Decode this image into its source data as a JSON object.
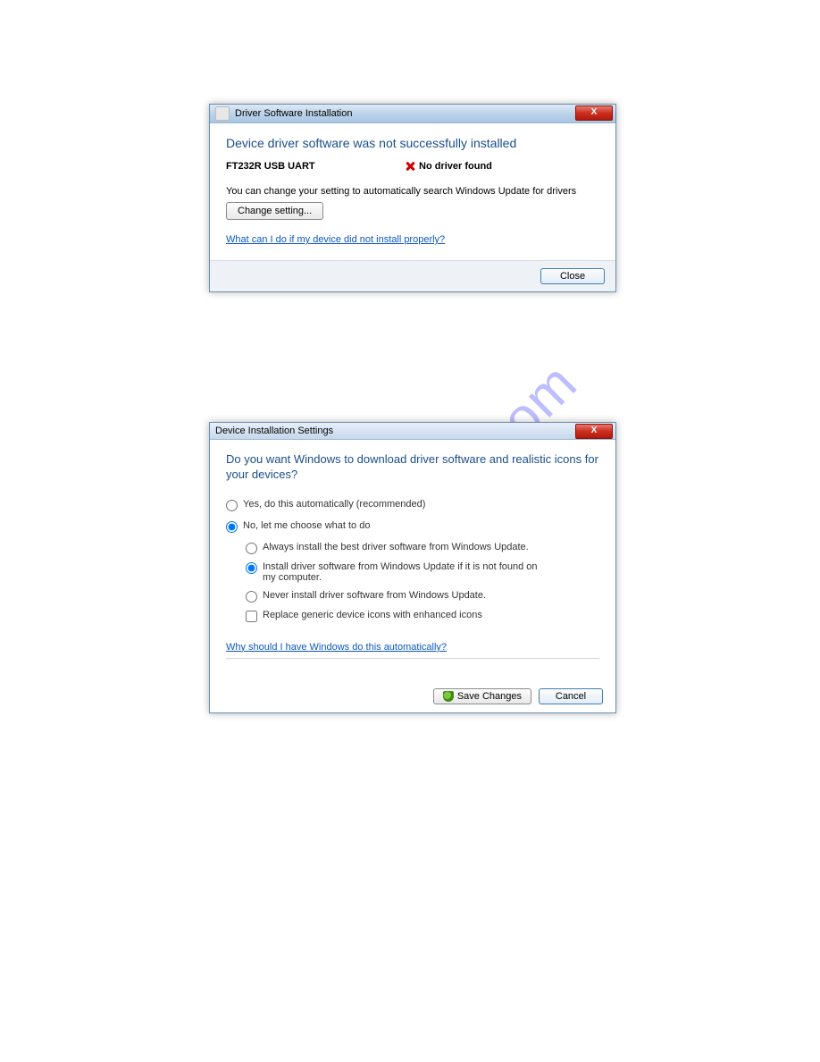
{
  "watermark": "manualshive.com",
  "dialog1": {
    "title": "Driver Software Installation",
    "closeX": "X",
    "headline": "Device driver software was not successfully installed",
    "device_name": "FT232R USB UART",
    "device_status": "No driver found",
    "info_text": "You can change your setting to automatically search Windows Update for drivers",
    "change_setting_label": "Change setting...",
    "help_link": "What can I do if my device did not install properly?",
    "close_label": "Close"
  },
  "dialog2": {
    "title": "Device Installation Settings",
    "closeX": "X",
    "headline": "Do you want Windows to download driver software and realistic icons for your devices?",
    "opt_yes": "Yes, do this automatically (recommended)",
    "opt_no": "No, let me choose what to do",
    "sub_always": "Always install the best driver software from Windows Update.",
    "sub_install_if": "Install driver software from Windows Update if it is not found on my computer.",
    "sub_never": "Never install driver software from Windows Update.",
    "chk_icons": "Replace generic device icons with enhanced icons",
    "help_link": "Why should I have Windows do this automatically?",
    "save_label": "Save Changes",
    "cancel_label": "Cancel",
    "selected_main": "no",
    "selected_sub": "install_if",
    "chk_icons_checked": false
  }
}
